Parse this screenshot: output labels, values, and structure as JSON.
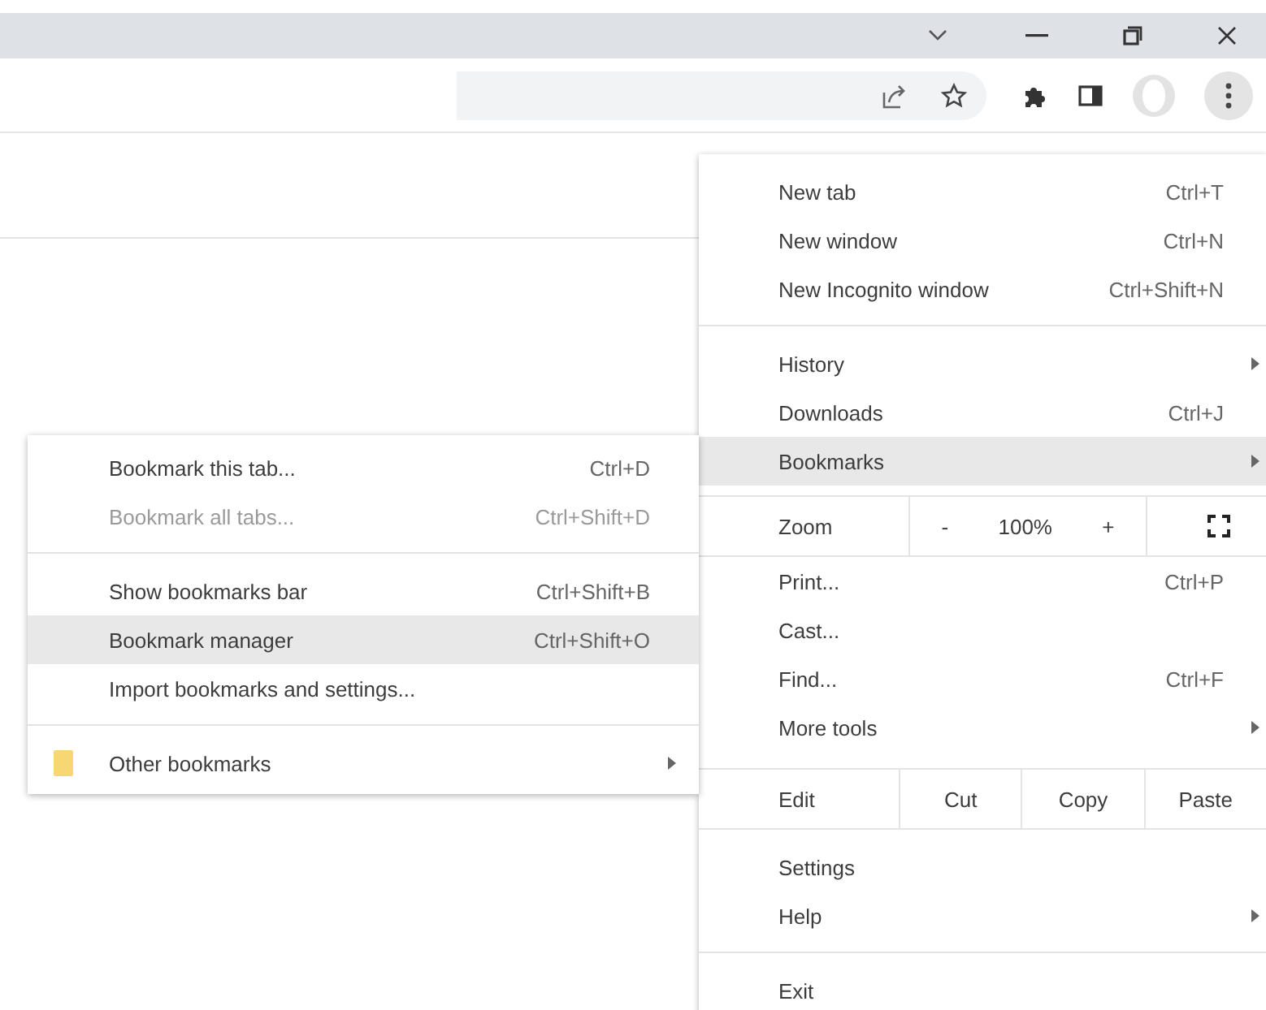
{
  "menu": [
    {
      "kind": "item",
      "label": "New tab",
      "shortcut": "Ctrl+T",
      "submenu": false,
      "selected": false
    },
    {
      "kind": "item",
      "label": "New window",
      "shortcut": "Ctrl+N",
      "submenu": false,
      "selected": false
    },
    {
      "kind": "item",
      "label": "New Incognito window",
      "shortcut": "Ctrl+Shift+N",
      "submenu": false,
      "selected": false
    },
    {
      "kind": "separator"
    },
    {
      "kind": "item",
      "label": "History",
      "submenu": true,
      "selected": false
    },
    {
      "kind": "item",
      "label": "Downloads",
      "shortcut": "Ctrl+J",
      "submenu": false,
      "selected": false
    },
    {
      "kind": "item",
      "label": "Bookmarks",
      "submenu": true,
      "selected": true
    },
    {
      "kind": "zoom",
      "label": "Zoom",
      "minus": "-",
      "value": "100%",
      "plus": "+"
    },
    {
      "kind": "item",
      "label": "Print...",
      "shortcut": "Ctrl+P",
      "submenu": false,
      "selected": false
    },
    {
      "kind": "item",
      "label": "Cast...",
      "submenu": false,
      "selected": false
    },
    {
      "kind": "item",
      "label": "Find...",
      "shortcut": "Ctrl+F",
      "submenu": false,
      "selected": false
    },
    {
      "kind": "item",
      "label": "More tools",
      "submenu": true,
      "selected": false
    },
    {
      "kind": "edit",
      "label": "Edit",
      "buttons": [
        "Cut",
        "Copy",
        "Paste"
      ]
    },
    {
      "kind": "item",
      "label": "Settings",
      "submenu": false,
      "selected": false
    },
    {
      "kind": "item",
      "label": "Help",
      "submenu": true,
      "selected": false
    },
    {
      "kind": "separator"
    },
    {
      "kind": "item",
      "label": "Exit",
      "submenu": false,
      "selected": false
    }
  ],
  "bookmarks_menu": [
    {
      "kind": "item",
      "label": "Bookmark this tab...",
      "shortcut": "Ctrl+D",
      "submenu": false,
      "selected": false,
      "disabled": false
    },
    {
      "kind": "item",
      "label": "Bookmark all tabs...",
      "shortcut": "Ctrl+Shift+D",
      "submenu": false,
      "selected": false,
      "disabled": true
    },
    {
      "kind": "separator"
    },
    {
      "kind": "item",
      "label": "Show bookmarks bar",
      "shortcut": "Ctrl+Shift+B",
      "submenu": false,
      "selected": false,
      "disabled": false
    },
    {
      "kind": "item",
      "label": "Bookmark manager",
      "shortcut": "Ctrl+Shift+O",
      "submenu": false,
      "selected": true,
      "disabled": false
    },
    {
      "kind": "item",
      "label": "Import bookmarks and settings...",
      "submenu": false,
      "selected": false,
      "disabled": false
    },
    {
      "kind": "separator"
    },
    {
      "kind": "folder",
      "label": "Other bookmarks",
      "submenu": true,
      "selected": false,
      "disabled": false
    }
  ]
}
